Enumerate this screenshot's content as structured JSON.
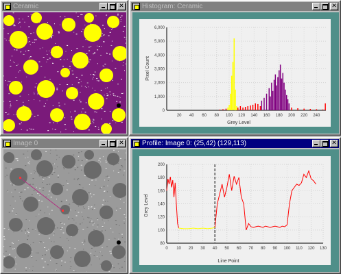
{
  "windows": {
    "ceramic": {
      "title": "Ceramic"
    },
    "histogram": {
      "title": "Histogram: Ceramic"
    },
    "image0": {
      "title": "Image 0"
    },
    "profile": {
      "title": "Profile: Image 0: (25,42) (129,113)"
    }
  },
  "icons": [
    "window-icon",
    "minimize-icon",
    "maximize-icon",
    "close-icon"
  ],
  "colors": {
    "titlebar_active": "#000080",
    "titlebar_inactive": "#808080",
    "plot_frame": "#4f8f89",
    "ceramic_matrix": "#7a1a7a",
    "particle_yellow": "#ffff00",
    "histogram_red": "#ff0000",
    "histogram_purple": "#800080",
    "profile_red": "#ff0000",
    "profile_yellow": "#ffff00"
  },
  "chart_data": [
    {
      "type": "bar",
      "title": "",
      "xlabel": "Grey Level",
      "ylabel": "Pixel Count",
      "xlim": [
        0,
        255
      ],
      "ylim": [
        0,
        6000
      ],
      "yticks": [
        "0",
        "1,000",
        "2,000",
        "3,000",
        "4,000",
        "5,000",
        "6,000"
      ],
      "xticks": [
        "20",
        "40",
        "60",
        "80",
        "100",
        "120",
        "140",
        "160",
        "180",
        "200",
        "220",
        "240"
      ],
      "series": [
        {
          "color": "#ffff00",
          "x": [
            98,
            100,
            102,
            104,
            106,
            108,
            110,
            112
          ],
          "values": [
            200,
            400,
            1200,
            2500,
            3500,
            5200,
            1500,
            300
          ]
        },
        {
          "color": "#ff0000",
          "x": [
            85,
            90,
            95,
            114,
            118,
            122,
            126,
            130,
            134,
            138,
            142,
            146,
            150,
            200,
            210,
            220,
            230,
            240,
            250,
            254
          ],
          "values": [
            50,
            80,
            120,
            200,
            300,
            200,
            250,
            300,
            350,
            400,
            500,
            450,
            300,
            200,
            150,
            120,
            100,
            80,
            60,
            500
          ]
        },
        {
          "color": "#800080",
          "x": [
            152,
            156,
            160,
            164,
            166,
            168,
            170,
            172,
            174,
            176,
            178,
            180,
            182,
            184,
            186,
            188,
            190,
            192,
            194,
            196
          ],
          "values": [
            700,
            900,
            1200,
            1600,
            1000,
            2000,
            1400,
            2200,
            2600,
            1800,
            2400,
            2900,
            3300,
            2300,
            2700,
            2000,
            1500,
            1100,
            800,
            500
          ]
        }
      ],
      "grid": true
    },
    {
      "type": "line",
      "title": "",
      "xlabel": "Line Point",
      "ylabel": "Grey Level",
      "xlim": [
        0,
        130
      ],
      "ylim": [
        80,
        200
      ],
      "yticks": [
        "80",
        "100",
        "120",
        "140",
        "160",
        "180",
        "200"
      ],
      "xticks": [
        "0",
        "10",
        "20",
        "30",
        "40",
        "50",
        "60",
        "70",
        "80",
        "90",
        "100",
        "110",
        "120",
        "130"
      ],
      "marker_x": 40,
      "series": [
        {
          "color": "#ff0000",
          "x": [
            0,
            1,
            2,
            3,
            4,
            5,
            6,
            7,
            8,
            9,
            10
          ],
          "y": [
            160,
            178,
            170,
            181,
            165,
            176,
            150,
            172,
            140,
            110,
            103
          ]
        },
        {
          "color": "#ffff00",
          "x": [
            10,
            14,
            18,
            22,
            26,
            30,
            34,
            38,
            40
          ],
          "y": [
            103,
            102,
            102,
            103,
            102,
            103,
            102,
            103,
            104
          ]
        },
        {
          "color": "#ff0000",
          "x": [
            40,
            42,
            44,
            46,
            48,
            50,
            52,
            54,
            56,
            58,
            60,
            62,
            64,
            66,
            68,
            70,
            72,
            74,
            76,
            78,
            80,
            82,
            84,
            86,
            88,
            90,
            92,
            94,
            96,
            98,
            100,
            102,
            104,
            106,
            108,
            110,
            112,
            114,
            116,
            118,
            120,
            122,
            124
          ],
          "y": [
            104,
            140,
            155,
            170,
            150,
            165,
            185,
            160,
            182,
            170,
            180,
            150,
            140,
            100,
            110,
            105,
            104,
            105,
            106,
            105,
            104,
            106,
            105,
            104,
            105,
            106,
            105,
            104,
            106,
            105,
            108,
            140,
            160,
            165,
            170,
            168,
            172,
            185,
            180,
            190,
            178,
            175,
            170
          ]
        }
      ],
      "grid": true
    }
  ]
}
